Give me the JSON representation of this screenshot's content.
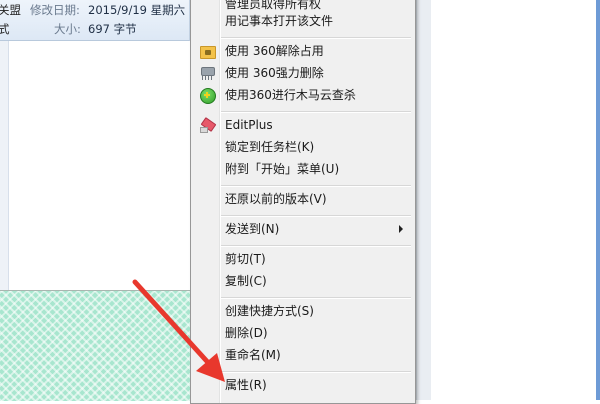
{
  "details_pane": {
    "row1_cut_text": "关盟",
    "modified_label": "修改日期:",
    "modified_value": "2015/9/19 星期六",
    "row2_cut_text": "式",
    "size_label": "大小:",
    "size_value": "697 字节"
  },
  "context_menu": {
    "top_partial": "管理员取得所有权",
    "open_with_notepad": "用记事本打开该文件",
    "unlock_360": "使用 360解除占用",
    "shred_360": "使用 360强力删除",
    "trojan_scan_360": "使用360进行木马云查杀",
    "editplus": "EditPlus",
    "pin_taskbar": "锁定到任务栏(K)",
    "pin_start": "附到「开始」菜单(U)",
    "restore_previous": "还原以前的版本(V)",
    "send_to": "发送到(N)",
    "cut": "剪切(T)",
    "copy": "复制(C)",
    "create_shortcut": "创建快捷方式(S)",
    "delete": "删除(D)",
    "rename": "重命名(M)",
    "properties": "属性(R)"
  },
  "icons": {
    "unlock": "folder-lock-icon",
    "shred": "shredder-icon",
    "trojan": "360-shield-icon",
    "editplus": "editplus-pen-icon",
    "submenu": "chevron-right-icon",
    "annotation": "red-arrow-icon"
  },
  "colors": {
    "arrow": "#e8382d",
    "menu_bg": "#f0f0f0",
    "desktop": "#a8e6cf"
  }
}
